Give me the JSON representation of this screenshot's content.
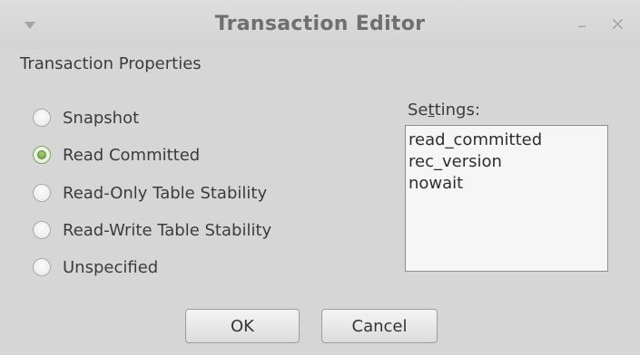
{
  "window": {
    "title": "Transaction Editor",
    "menu_icon": "triangle-down-icon",
    "minimize_label": "–",
    "close_label": "×"
  },
  "section": {
    "label": "Transaction Properties"
  },
  "isolation_options": [
    {
      "label": "Snapshot",
      "checked": false
    },
    {
      "label": "Read Committed",
      "checked": true
    },
    {
      "label": "Read-Only Table Stability",
      "checked": false
    },
    {
      "label": "Read-Write Table Stability",
      "checked": false
    },
    {
      "label": "Unspecified",
      "checked": false
    }
  ],
  "settings": {
    "label_before": "Se",
    "label_mnemonic": "t",
    "label_after": "tings:",
    "items": [
      "read_committed",
      "rec_version",
      "nowait"
    ]
  },
  "buttons": {
    "ok_label": "OK",
    "cancel_label": "Cancel"
  },
  "colors": {
    "selected_radio": "#6e9d43",
    "window_bg": "#d6d6d6"
  }
}
